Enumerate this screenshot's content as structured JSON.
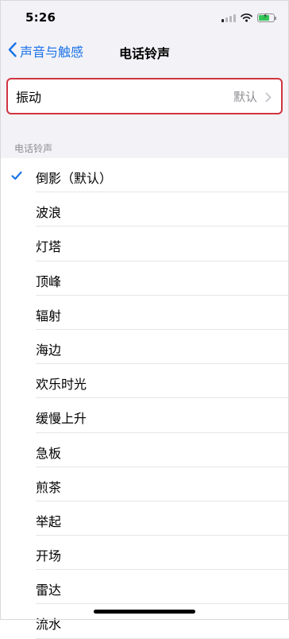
{
  "status_bar": {
    "time": "5:26",
    "battery_level": 0.7
  },
  "nav": {
    "back_label": "声音与触感",
    "title": "电话铃声"
  },
  "vibration": {
    "label": "振动",
    "value": "默认"
  },
  "section": {
    "header": "电话铃声"
  },
  "ringtones": [
    {
      "label": "倒影（默认）",
      "selected": true
    },
    {
      "label": "波浪",
      "selected": false
    },
    {
      "label": "灯塔",
      "selected": false
    },
    {
      "label": "顶峰",
      "selected": false
    },
    {
      "label": "辐射",
      "selected": false
    },
    {
      "label": "海边",
      "selected": false
    },
    {
      "label": "欢乐时光",
      "selected": false
    },
    {
      "label": "缓慢上升",
      "selected": false
    },
    {
      "label": "急板",
      "selected": false
    },
    {
      "label": "煎茶",
      "selected": false
    },
    {
      "label": "举起",
      "selected": false
    },
    {
      "label": "开场",
      "selected": false
    },
    {
      "label": "雷达",
      "selected": false
    },
    {
      "label": "流水",
      "selected": false
    }
  ],
  "colors": {
    "accent": "#1a73e8",
    "highlight_border": "#d0343f",
    "secondary_text": "#8e8e93"
  }
}
